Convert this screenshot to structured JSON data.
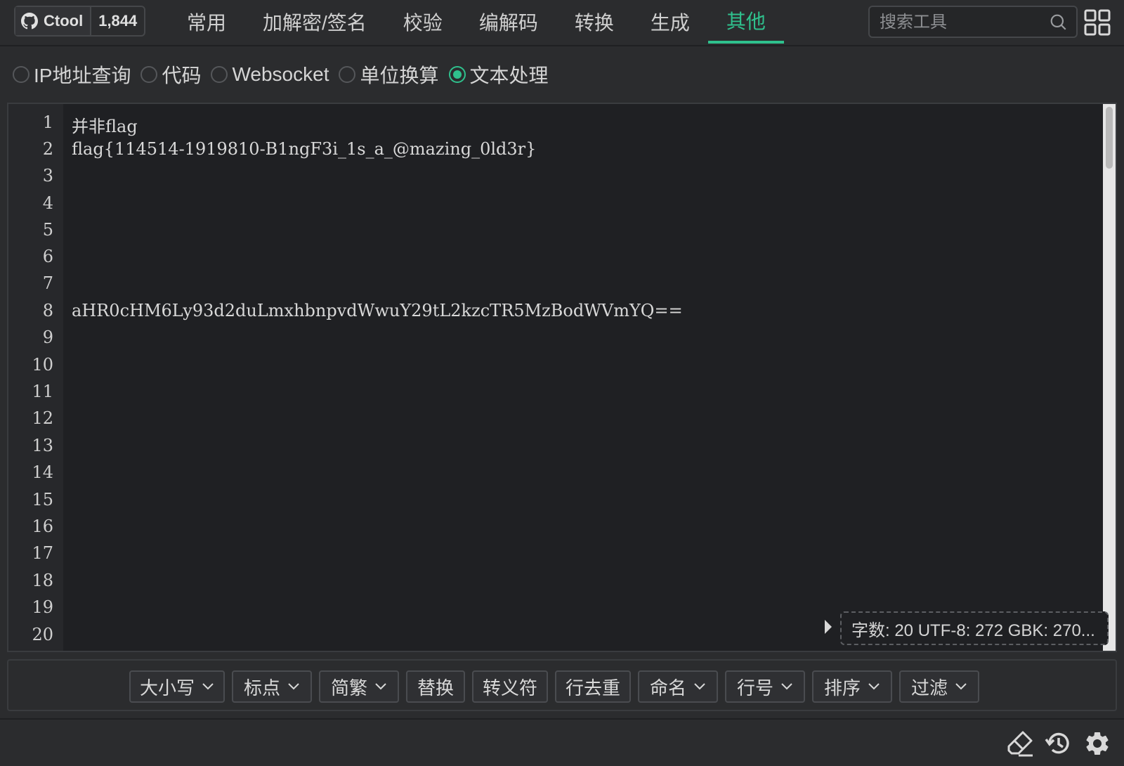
{
  "header": {
    "brand": "Ctool",
    "stars": "1,844",
    "tabs": [
      "常用",
      "加解密/签名",
      "校验",
      "编解码",
      "转换",
      "生成",
      "其他"
    ],
    "active_tab": "其他",
    "search_placeholder": "搜索工具"
  },
  "tools": {
    "radios": [
      "IP地址查询",
      "代码",
      "Websocket",
      "单位换算",
      "文本处理"
    ],
    "selected": "文本处理"
  },
  "editor": {
    "line_numbers": [
      "1",
      "2",
      "3",
      "4",
      "5",
      "6",
      "7",
      "8",
      "9",
      "10",
      "11",
      "12",
      "13",
      "14",
      "15",
      "16",
      "17",
      "18",
      "19",
      "20"
    ],
    "lines": {
      "l1": "并非flag",
      "l2": "flag{114514-1919810-B1ngF3i_1s_a_@mazing_0ld3r}",
      "l8": "aHR0cHM6Ly93d2duLmxhbnpvdWwuY29tL2kzcTR5MzBodWVmYQ=="
    },
    "stats": "字数: 20 UTF-8: 272 GBK: 270..."
  },
  "actions": {
    "case": "大小写",
    "punct": "标点",
    "simp_trad": "简繁",
    "replace": "替换",
    "escape": "转义符",
    "dedupe": "行去重",
    "naming": "命名",
    "line_no": "行号",
    "sort": "排序",
    "filter": "过滤"
  },
  "icons": {
    "github": "github-icon",
    "search": "search-icon",
    "grid": "grid-icon",
    "eraser": "eraser-icon",
    "history": "history-icon",
    "settings": "gear-icon"
  },
  "colors": {
    "accent": "#2fc18d",
    "background": "#2b2c2e",
    "editor_bg": "#1f2023"
  }
}
